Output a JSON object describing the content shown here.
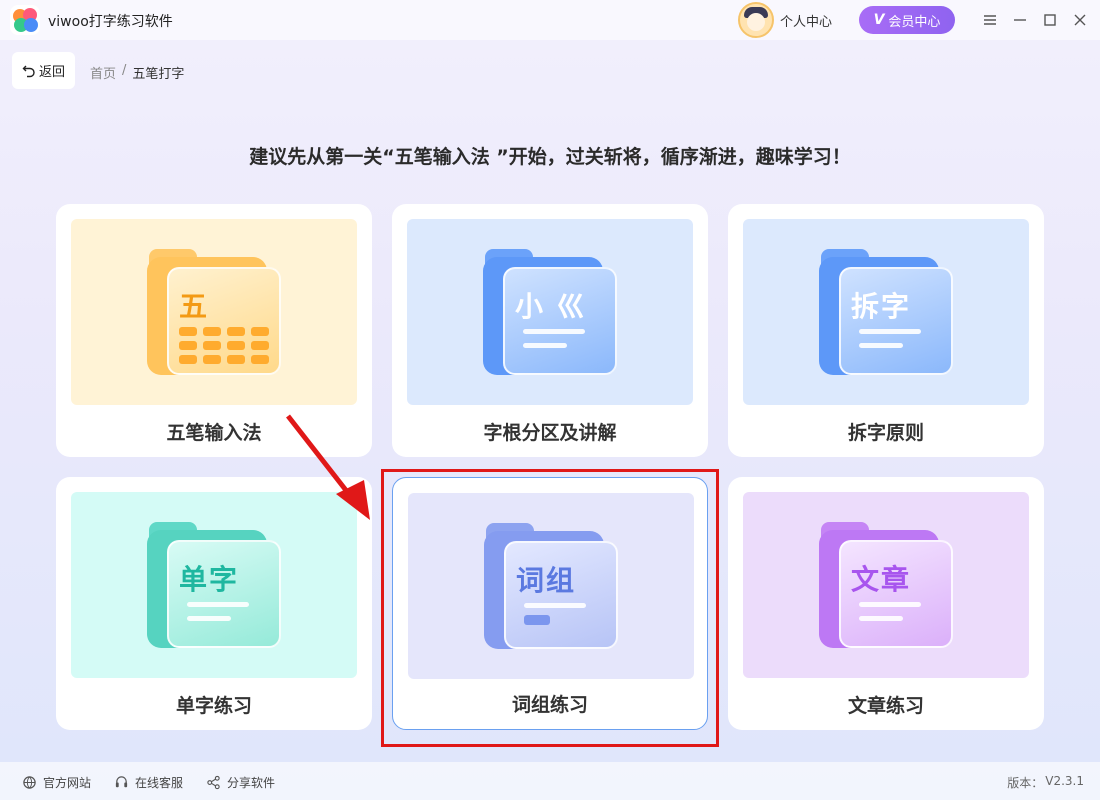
{
  "app": {
    "title": "viwoo打字练习软件"
  },
  "header": {
    "user_center": "个人中心",
    "vip_label": "会员中心",
    "vip_icon": "V"
  },
  "nav": {
    "back_label": "返回",
    "breadcrumb_home": "首页",
    "breadcrumb_sep": "/",
    "breadcrumb_current": "五笔打字"
  },
  "main": {
    "headline": "建议先从第一关“五笔输入法 ”开始，过关斩将，循序渐进，趣味学习！",
    "cards": [
      {
        "label": "五笔输入法",
        "icon_text": "五",
        "icon": "keyboard-folder-icon",
        "color": "#ffb33a"
      },
      {
        "label": "字根分区及讲解",
        "icon_text": "小 巛",
        "icon": "radical-folder-icon",
        "color": "#4a8df7"
      },
      {
        "label": "拆字原则",
        "icon_text": "拆字",
        "icon": "split-folder-icon",
        "color": "#4a8df7"
      },
      {
        "label": "单字练习",
        "icon_text": "单字",
        "icon": "single-char-folder-icon",
        "color": "#35c9b4"
      },
      {
        "label": "词组练习",
        "icon_text": "词组",
        "icon": "phrase-folder-icon",
        "color": "#6f86e6"
      },
      {
        "label": "文章练习",
        "icon_text": "文章",
        "icon": "article-folder-icon",
        "color": "#b26cf0"
      }
    ]
  },
  "footer": {
    "official_site": "官方网站",
    "online_service": "在线客服",
    "share_software": "分享软件",
    "version_label": "版本：",
    "version_value": "V2.3.1"
  }
}
